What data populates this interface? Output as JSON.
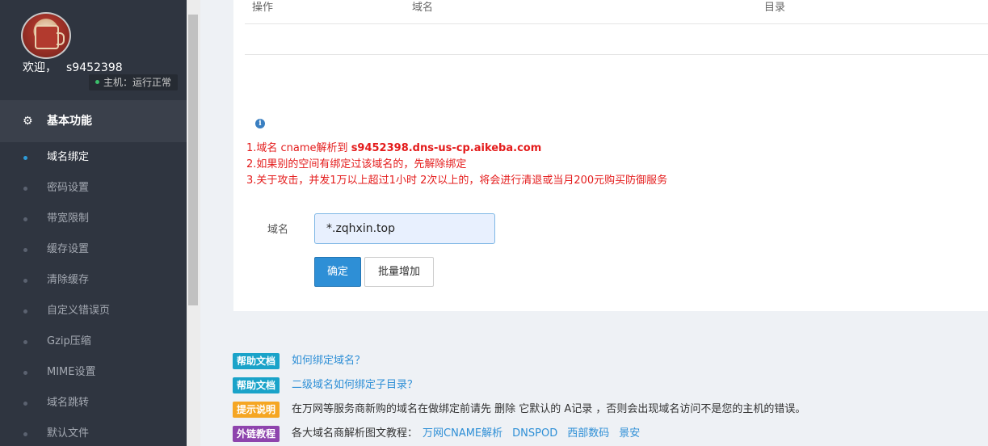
{
  "sidebar": {
    "welcome": "欢迎，",
    "username": "s9452398",
    "host_status": "主机：运行正常",
    "section_title": "基本功能",
    "items": [
      {
        "label": "域名绑定"
      },
      {
        "label": "密码设置"
      },
      {
        "label": "带宽限制"
      },
      {
        "label": "缓存设置"
      },
      {
        "label": "清除缓存"
      },
      {
        "label": "自定义错误页"
      },
      {
        "label": "Gzip压缩"
      },
      {
        "label": "MIME设置"
      },
      {
        "label": "域名跳转"
      },
      {
        "label": "默认文件"
      }
    ]
  },
  "table": {
    "col_action": "操作",
    "col_domain": "域名",
    "col_dir": "目录"
  },
  "notice": {
    "line1_prefix": "1.域名 cname解析到 ",
    "line1_host": "s9452398.dns-us-cp.aikeba.com",
    "line2": "2.如果别的空间有绑定过该域名的，先解除绑定",
    "line3": "3.关于攻击，并发1万以上超过1小时 2次以上的，将会进行清退或当月200元购买防御服务"
  },
  "form": {
    "label": "域名",
    "value": "*.zqhxin.top",
    "confirm": "确定",
    "batch_add": "批量增加"
  },
  "help": {
    "row1": {
      "badge": "帮助文档",
      "text": "如何绑定域名？"
    },
    "row2": {
      "badge": "帮助文档",
      "text": "二级域名如何绑定子目录？"
    },
    "row3": {
      "badge": "提示说明",
      "text": "在万网等服务商新购的域名在做绑定前请先 删除 它默认的 A记录 ，否则会出现域名访问不是您的主机的错误。"
    },
    "row4": {
      "badge": "外链教程",
      "text": "各大域名商解析图文教程：",
      "links": [
        "万网CNAME解析",
        "DNSPOD",
        "西部数码",
        "景安"
      ]
    }
  },
  "colors": {
    "sidebar_bg": "#2f3540",
    "accent": "#2e8fd6",
    "badge_help": "#1aa3c9",
    "badge_tip": "#f5a623",
    "badge_link": "#8e44ad",
    "notice": "#e41c1c"
  }
}
